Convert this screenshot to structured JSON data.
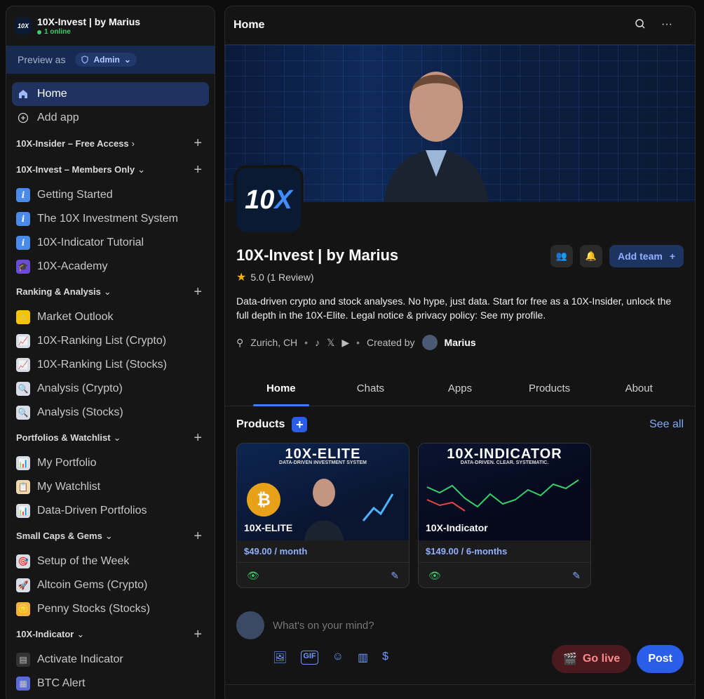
{
  "sidebar": {
    "community_name": "10X-Invest | by Marius",
    "online": "1 online",
    "preview_label": "Preview as",
    "preview_role": "Admin",
    "home": "Home",
    "add_app": "Add app",
    "sections": [
      {
        "title": "10X-Insider – Free Access",
        "chevron": "›",
        "items": []
      },
      {
        "title": "10X-Invest – Members Only",
        "chevron": "⌄",
        "items": [
          {
            "label": "Getting Started",
            "icon": "info-icon"
          },
          {
            "label": "The 10X Investment System",
            "icon": "info-icon"
          },
          {
            "label": "10X-Indicator Tutorial",
            "icon": "info-icon"
          },
          {
            "label": "10X-Academy",
            "icon": "graduation-cap-icon"
          }
        ]
      },
      {
        "title": "Ranking & Analysis",
        "chevron": "⌄",
        "items": [
          {
            "label": "Market Outlook",
            "icon": "warning-icon"
          },
          {
            "label": "10X-Ranking List (Crypto)",
            "icon": "chart-icon"
          },
          {
            "label": "10X-Ranking List (Stocks)",
            "icon": "chart-icon"
          },
          {
            "label": "Analysis (Crypto)",
            "icon": "magnifier-icon"
          },
          {
            "label": "Analysis (Stocks)",
            "icon": "magnifier-icon"
          }
        ]
      },
      {
        "title": "Portfolios & Watchlist",
        "chevron": "⌄",
        "items": [
          {
            "label": "My Portfolio",
            "icon": "bar-chart-icon"
          },
          {
            "label": "My Watchlist",
            "icon": "clipboard-icon"
          },
          {
            "label": "Data-Driven Portfolios",
            "icon": "bar-chart-icon"
          }
        ]
      },
      {
        "title": "Small Caps & Gems",
        "chevron": "⌄",
        "items": [
          {
            "label": "Setup of the Week",
            "icon": "target-icon"
          },
          {
            "label": "Altcoin Gems (Crypto)",
            "icon": "rocket-icon"
          },
          {
            "label": "Penny Stocks (Stocks)",
            "icon": "coin-icon"
          }
        ]
      },
      {
        "title": "10X-Indicator",
        "chevron": "⌄",
        "items": [
          {
            "label": "Activate Indicator",
            "icon": "indicator-icon"
          },
          {
            "label": "BTC Alert",
            "icon": "calculator-icon"
          }
        ]
      }
    ]
  },
  "header": {
    "title": "Home"
  },
  "profile": {
    "logo_text": "10",
    "logo_accent": "X",
    "name": "10X-Invest | by Marius",
    "rating": "5.0 (1 Review)",
    "description": "Data-driven crypto and stock analyses. No hype, just data. Start for free as a 10X-Insider, unlock the full depth in the 10X-Elite. Legal notice & privacy policy: See my profile.",
    "location": "Zurich, CH",
    "created_by_label": "Created by",
    "creator": "Marius",
    "add_team": "Add team"
  },
  "tabs": [
    "Home",
    "Chats",
    "Apps",
    "Products",
    "About"
  ],
  "products": {
    "title": "Products",
    "see_all": "See all",
    "items": [
      {
        "banner_title": "10X-ELITE",
        "banner_sub": "DATA-DRIVEN INVESTMENT SYSTEM",
        "name": "10X-ELITE",
        "price": "$49.00 / month"
      },
      {
        "banner_title": "10X-INDICATOR",
        "banner_sub": "DATA-DRIVEN. CLEAR. SYSTEMATIC.",
        "name": "10X-Indicator",
        "price": "$149.00 / 6-months"
      }
    ]
  },
  "composer": {
    "placeholder": "What's on your mind?",
    "go_live": "Go live",
    "post": "Post"
  },
  "colors": {
    "accent": "#2a5ee8",
    "online": "#3ecf6e",
    "active_nav": "#1f3260"
  }
}
